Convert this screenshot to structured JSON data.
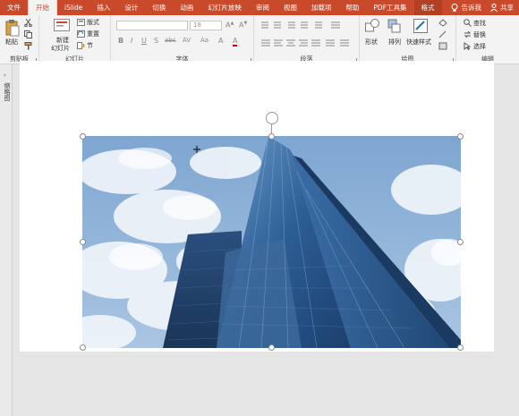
{
  "menu": {
    "tabs": [
      "文件",
      "开始",
      "iSlide",
      "插入",
      "设计",
      "切换",
      "动画",
      "幻灯片放映",
      "审阅",
      "视图",
      "加载项",
      "帮助",
      "PDF工具集",
      "格式"
    ],
    "active_index": 1,
    "tell_me": "告诉我",
    "share": "共享"
  },
  "ribbon": {
    "clipboard": {
      "paste": "粘贴",
      "label": "剪贴板"
    },
    "slides": {
      "new_slide_line1": "新建",
      "new_slide_line2": "幻灯片",
      "layout": "版式",
      "reset": "重置",
      "section": "节",
      "label": "幻灯片"
    },
    "font": {
      "size": "18",
      "bold": "B",
      "italic": "I",
      "underline": "U",
      "strike": "S",
      "spacing": "AV",
      "case": "Aa",
      "clear": "A",
      "color": "A",
      "label": "字体"
    },
    "paragraph": {
      "label": "段落"
    },
    "drawing": {
      "shapes": "形状",
      "arrange": "排列",
      "quick_styles": "快速样式",
      "label": "绘图"
    },
    "editing": {
      "find": "查找",
      "replace": "替换",
      "select": "选择",
      "label": "编辑"
    }
  },
  "left_panel": {
    "label": "缩略图"
  },
  "colors": {
    "accent": "#c94a2b",
    "ribbon_bg": "#f3f3f3"
  },
  "image_description_icon": "building-photo"
}
